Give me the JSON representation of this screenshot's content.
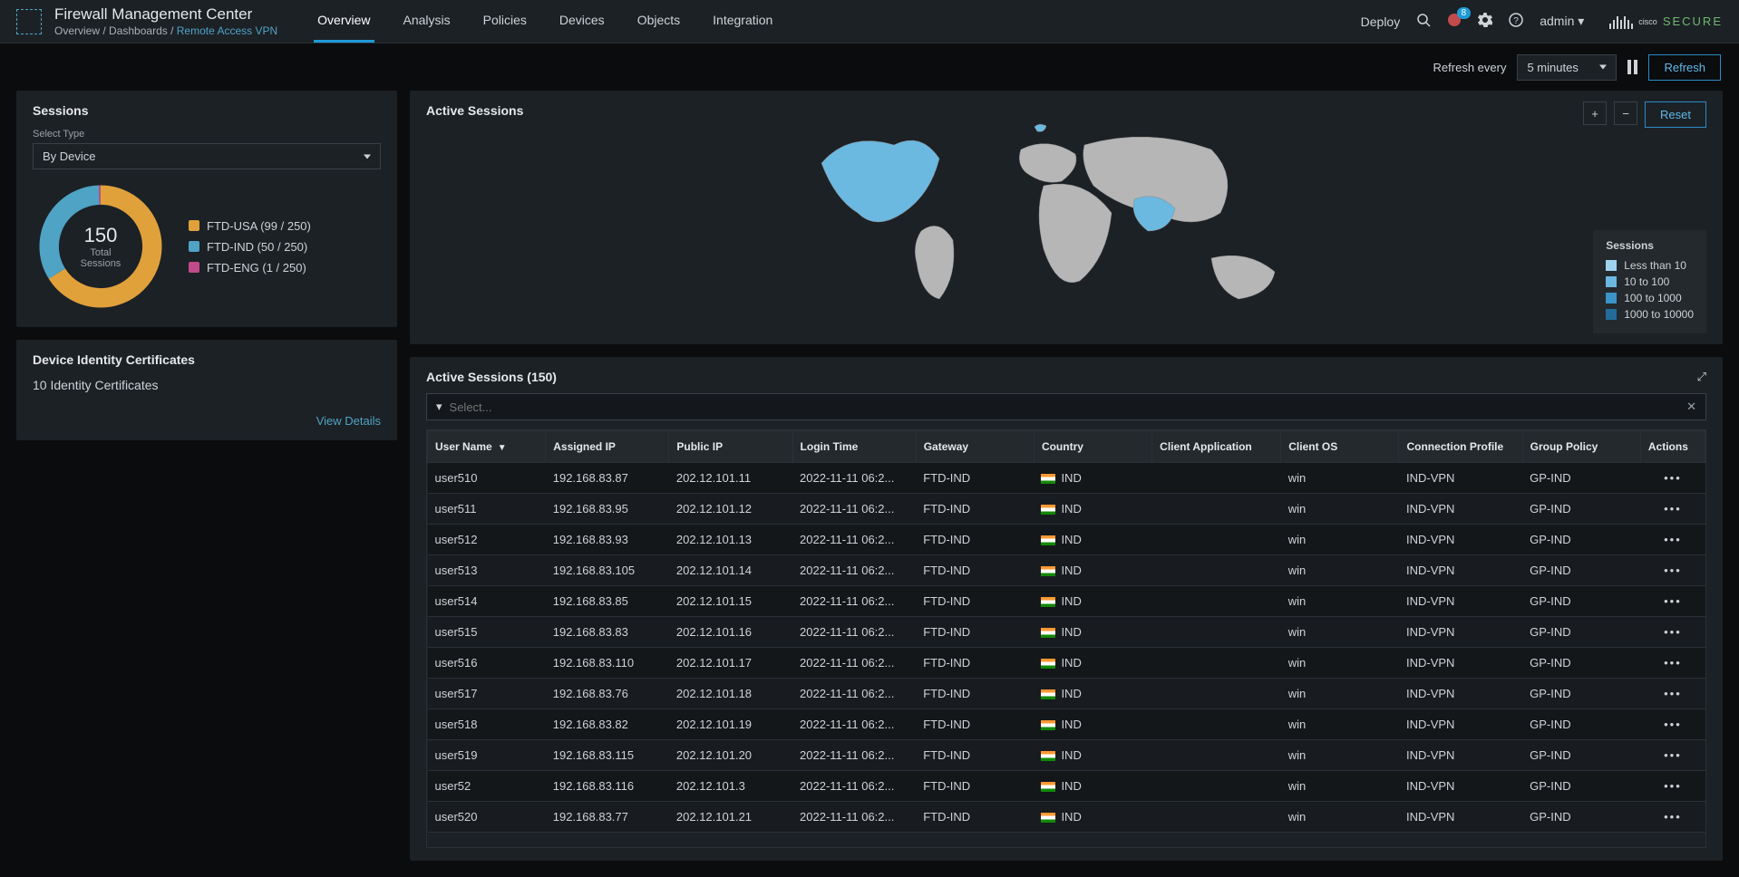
{
  "header": {
    "app_title": "Firewall Management Center",
    "breadcrumb": {
      "p1": "Overview",
      "sep": " / ",
      "p2": "Dashboards",
      "p3": "Remote Access VPN"
    },
    "nav": [
      "Overview",
      "Analysis",
      "Policies",
      "Devices",
      "Objects",
      "Integration"
    ],
    "active_nav_index": 0,
    "deploy": "Deploy",
    "bell_count": "8",
    "user": "admin ▾",
    "secure": "SECURE",
    "cisco": "cisco"
  },
  "action_row": {
    "refresh_label": "Refresh every",
    "interval": "5 minutes",
    "refresh_btn": "Refresh"
  },
  "sessions_panel": {
    "title": "Sessions",
    "select_label": "Select Type",
    "select_value": "By Device",
    "total_number": "150",
    "total_label1": "Total",
    "total_label2": "Sessions",
    "legend": [
      {
        "label": "FTD-USA (99 / 250)",
        "color": "#e0a13b"
      },
      {
        "label": "FTD-IND (50 / 250)",
        "color": "#4fa3c4"
      },
      {
        "label": "FTD-ENG (1 / 250)",
        "color": "#c14b8a"
      }
    ]
  },
  "chart_data": {
    "type": "pie",
    "title": "Sessions by Device",
    "series": [
      {
        "name": "FTD-USA",
        "value": 99,
        "capacity": 250,
        "color": "#e0a13b"
      },
      {
        "name": "FTD-IND",
        "value": 50,
        "capacity": 250,
        "color": "#4fa3c4"
      },
      {
        "name": "FTD-ENG",
        "value": 1,
        "capacity": 250,
        "color": "#c14b8a"
      }
    ],
    "total": 150
  },
  "cert_panel": {
    "title": "Device Identity Certificates",
    "text": "10 Identity Certificates",
    "link": "View Details"
  },
  "map_panel": {
    "title": "Active Sessions",
    "reset": "Reset",
    "legend_title": "Sessions",
    "legend": [
      {
        "label": "Less than 10",
        "color": "#9ed3ef"
      },
      {
        "label": "10 to 100",
        "color": "#6bb8e0"
      },
      {
        "label": "100 to 1000",
        "color": "#3b93c7"
      },
      {
        "label": "1000 to 10000",
        "color": "#236c99"
      }
    ]
  },
  "table_panel": {
    "title": "Active Sessions (150)",
    "filter_placeholder": "Select...",
    "columns": [
      "User Name",
      "Assigned IP",
      "Public IP",
      "Login Time",
      "Gateway",
      "Country",
      "Client Application",
      "Client OS",
      "Connection Profile",
      "Group Policy",
      "Actions"
    ],
    "rows": [
      {
        "user": "user510",
        "aip": "192.168.83.87",
        "pip": "202.12.101.11",
        "login": "2022-11-11 06:2...",
        "gw": "FTD-IND",
        "country": "IND",
        "capp": "",
        "cos": "win",
        "cp": "IND-VPN",
        "gp": "GP-IND"
      },
      {
        "user": "user511",
        "aip": "192.168.83.95",
        "pip": "202.12.101.12",
        "login": "2022-11-11 06:2...",
        "gw": "FTD-IND",
        "country": "IND",
        "capp": "",
        "cos": "win",
        "cp": "IND-VPN",
        "gp": "GP-IND"
      },
      {
        "user": "user512",
        "aip": "192.168.83.93",
        "pip": "202.12.101.13",
        "login": "2022-11-11 06:2...",
        "gw": "FTD-IND",
        "country": "IND",
        "capp": "",
        "cos": "win",
        "cp": "IND-VPN",
        "gp": "GP-IND"
      },
      {
        "user": "user513",
        "aip": "192.168.83.105",
        "pip": "202.12.101.14",
        "login": "2022-11-11 06:2...",
        "gw": "FTD-IND",
        "country": "IND",
        "capp": "",
        "cos": "win",
        "cp": "IND-VPN",
        "gp": "GP-IND"
      },
      {
        "user": "user514",
        "aip": "192.168.83.85",
        "pip": "202.12.101.15",
        "login": "2022-11-11 06:2...",
        "gw": "FTD-IND",
        "country": "IND",
        "capp": "",
        "cos": "win",
        "cp": "IND-VPN",
        "gp": "GP-IND"
      },
      {
        "user": "user515",
        "aip": "192.168.83.83",
        "pip": "202.12.101.16",
        "login": "2022-11-11 06:2...",
        "gw": "FTD-IND",
        "country": "IND",
        "capp": "",
        "cos": "win",
        "cp": "IND-VPN",
        "gp": "GP-IND"
      },
      {
        "user": "user516",
        "aip": "192.168.83.110",
        "pip": "202.12.101.17",
        "login": "2022-11-11 06:2...",
        "gw": "FTD-IND",
        "country": "IND",
        "capp": "",
        "cos": "win",
        "cp": "IND-VPN",
        "gp": "GP-IND"
      },
      {
        "user": "user517",
        "aip": "192.168.83.76",
        "pip": "202.12.101.18",
        "login": "2022-11-11 06:2...",
        "gw": "FTD-IND",
        "country": "IND",
        "capp": "",
        "cos": "win",
        "cp": "IND-VPN",
        "gp": "GP-IND"
      },
      {
        "user": "user518",
        "aip": "192.168.83.82",
        "pip": "202.12.101.19",
        "login": "2022-11-11 06:2...",
        "gw": "FTD-IND",
        "country": "IND",
        "capp": "",
        "cos": "win",
        "cp": "IND-VPN",
        "gp": "GP-IND"
      },
      {
        "user": "user519",
        "aip": "192.168.83.115",
        "pip": "202.12.101.20",
        "login": "2022-11-11 06:2...",
        "gw": "FTD-IND",
        "country": "IND",
        "capp": "",
        "cos": "win",
        "cp": "IND-VPN",
        "gp": "GP-IND"
      },
      {
        "user": "user52",
        "aip": "192.168.83.116",
        "pip": "202.12.101.3",
        "login": "2022-11-11 06:2...",
        "gw": "FTD-IND",
        "country": "IND",
        "capp": "",
        "cos": "win",
        "cp": "IND-VPN",
        "gp": "GP-IND"
      },
      {
        "user": "user520",
        "aip": "192.168.83.77",
        "pip": "202.12.101.21",
        "login": "2022-11-11 06:2...",
        "gw": "FTD-IND",
        "country": "IND",
        "capp": "",
        "cos": "win",
        "cp": "IND-VPN",
        "gp": "GP-IND"
      }
    ]
  }
}
